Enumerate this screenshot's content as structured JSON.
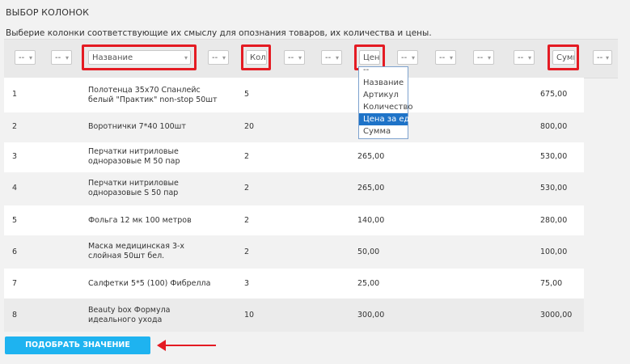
{
  "header": {
    "title": "ВЫБОР КОЛОНОК",
    "subtitle": "Выберие колонки соответствующие их смыслу для опознания товаров, их количества и цены."
  },
  "selectors": {
    "blank": "--",
    "name": "Название",
    "qty": "Коли",
    "price": "Цен",
    "sum": "Сумм"
  },
  "dropdown": {
    "options": [
      "--",
      "Название",
      "Артикул",
      "Количество",
      "Цена за ед",
      "Сумма"
    ],
    "selected": "Цена за ед"
  },
  "rows": [
    {
      "num": "1",
      "name": "Полотенца 35х70 Спанлейс\nбелый \"Практик\" non-stop 50шт",
      "qty": "5",
      "price": "",
      "sum": "675,00"
    },
    {
      "num": "2",
      "name": "Воротнички 7*40 100шт",
      "qty": "20",
      "price": "",
      "sum": "800,00"
    },
    {
      "num": "3",
      "name": "Перчатки нитриловые\nодноразовые M 50 пар",
      "qty": "2",
      "price": "265,00",
      "sum": "530,00"
    },
    {
      "num": "4",
      "name": "Перчатки нитриловые\nодноразовые S 50 пар",
      "qty": "2",
      "price": "265,00",
      "sum": "530,00"
    },
    {
      "num": "5",
      "name": "Фольга 12 мк 100 метров",
      "qty": "2",
      "price": "140,00",
      "sum": "280,00"
    },
    {
      "num": "6",
      "name": "Маска медицинская 3-х\nслойная 50шт бел.",
      "qty": "2",
      "price": "50,00",
      "sum": "100,00"
    },
    {
      "num": "7",
      "name": "Салфетки 5*5 (100) Фибрелла",
      "qty": "3",
      "price": "25,00",
      "sum": "75,00"
    },
    {
      "num": "8",
      "name": "Beauty box Формула\nидеального ухода",
      "qty": "10",
      "price": "300,00",
      "sum": "3000,00"
    }
  ],
  "button": {
    "label": "ПОДОБРАТЬ ЗНАЧЕНИЕ"
  },
  "colors": {
    "highlight": "#e41b23",
    "button": "#1eb3f0",
    "dropdown_active": "#1e73c8"
  }
}
